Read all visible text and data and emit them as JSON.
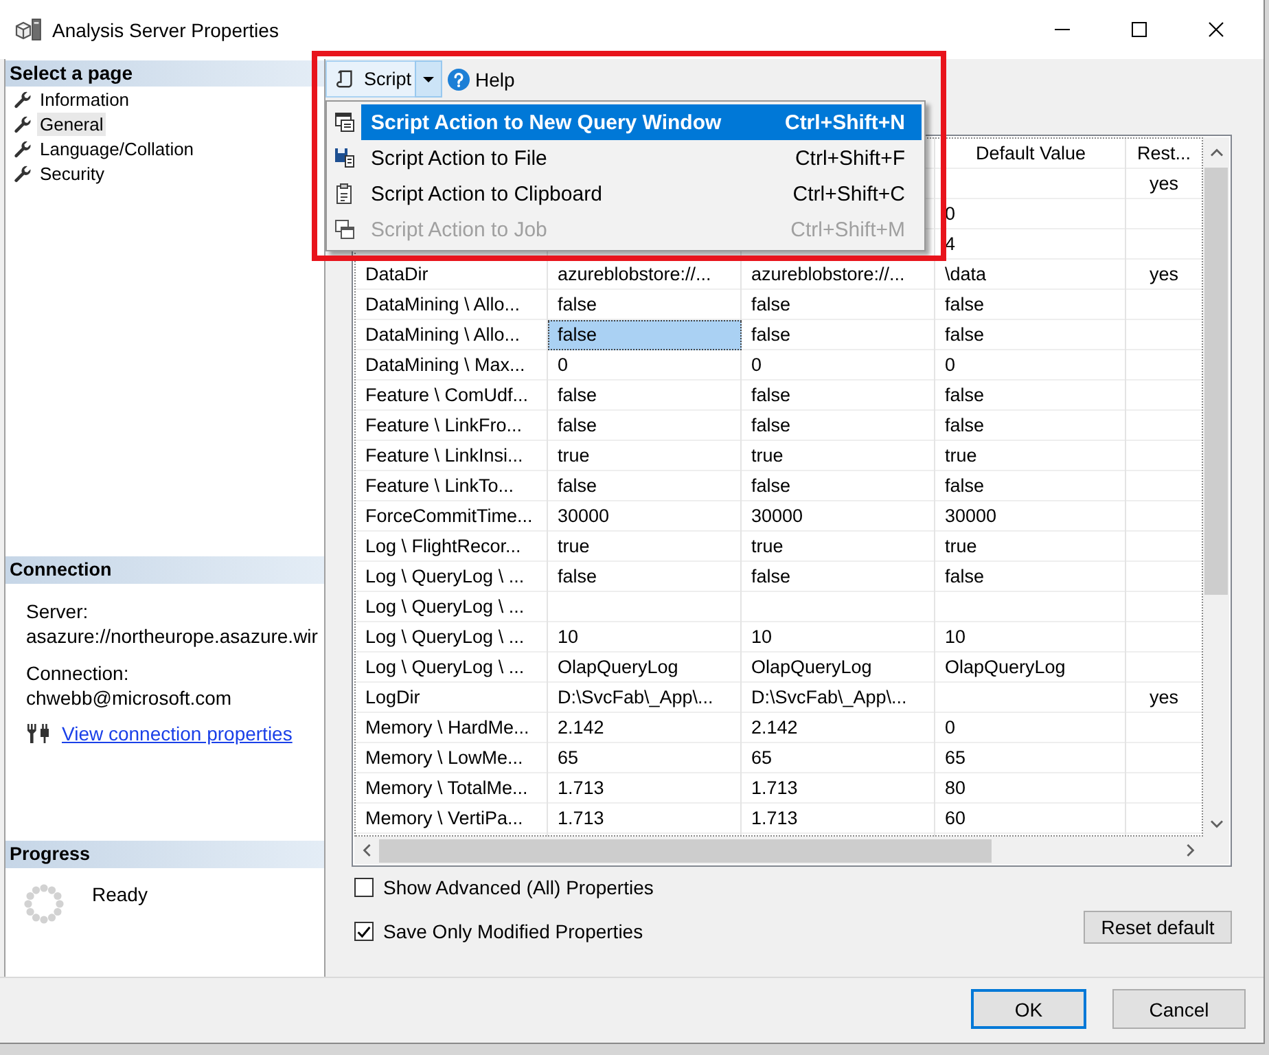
{
  "window": {
    "title": "Analysis Server Properties"
  },
  "sidebar": {
    "header": "Select a page",
    "items": [
      {
        "label": "Information",
        "selected": false
      },
      {
        "label": "General",
        "selected": true
      },
      {
        "label": "Language/Collation",
        "selected": false
      },
      {
        "label": "Security",
        "selected": false
      }
    ]
  },
  "connection": {
    "header": "Connection",
    "server_label": "Server:",
    "server": "asazure://northeurope.asazure.wir",
    "connection_label": "Connection:",
    "connection": "chwebb@microsoft.com",
    "link": "View connection properties"
  },
  "progress": {
    "header": "Progress",
    "status": "Ready"
  },
  "toolbar": {
    "script_button": "Script",
    "help_button": "Help"
  },
  "script_menu": {
    "open": true,
    "items": [
      {
        "label": "Script Action to New Query Window",
        "shortcut": "Ctrl+Shift+N",
        "selected": true,
        "disabled": false
      },
      {
        "label": "Script Action to File",
        "shortcut": "Ctrl+Shift+F",
        "selected": false,
        "disabled": false
      },
      {
        "label": "Script Action to Clipboard",
        "shortcut": "Ctrl+Shift+C",
        "selected": false,
        "disabled": false
      },
      {
        "label": "Script Action to Job",
        "shortcut": "Ctrl+Shift+M",
        "selected": false,
        "disabled": true
      }
    ]
  },
  "table": {
    "columns": [
      null,
      null,
      null,
      "Default Value",
      "Rest..."
    ],
    "rows": [
      {
        "cells": [
          null,
          null,
          null,
          null,
          "yes"
        ],
        "selected": false
      },
      {
        "cells": [
          null,
          null,
          null,
          "0",
          null
        ],
        "selected": false
      },
      {
        "cells": [
          null,
          null,
          null,
          "4",
          null
        ],
        "selected": false
      },
      {
        "cells": [
          "DataDir",
          "azureblobstore://...",
          "azureblobstore://...",
          "\\data",
          "yes"
        ],
        "selected": false
      },
      {
        "cells": [
          "DataMining \\ Allo...",
          "false",
          "false",
          "false",
          null
        ],
        "selected": false
      },
      {
        "cells": [
          "DataMining \\ Allo...",
          "false",
          "false",
          "false",
          null
        ],
        "selected": true
      },
      {
        "cells": [
          "DataMining \\ Max...",
          "0",
          "0",
          "0",
          null
        ],
        "selected": false
      },
      {
        "cells": [
          "Feature \\ ComUdf...",
          "false",
          "false",
          "false",
          null
        ],
        "selected": false
      },
      {
        "cells": [
          "Feature \\ LinkFro...",
          "false",
          "false",
          "false",
          null
        ],
        "selected": false
      },
      {
        "cells": [
          "Feature \\ LinkInsi...",
          "true",
          "true",
          "true",
          null
        ],
        "selected": false
      },
      {
        "cells": [
          "Feature \\ LinkTo...",
          "false",
          "false",
          "false",
          null
        ],
        "selected": false
      },
      {
        "cells": [
          "ForceCommitTime...",
          "30000",
          "30000",
          "30000",
          null
        ],
        "selected": false
      },
      {
        "cells": [
          "Log \\ FlightRecor...",
          "true",
          "true",
          "true",
          null
        ],
        "selected": false
      },
      {
        "cells": [
          "Log \\ QueryLog \\ ...",
          "false",
          "false",
          "false",
          null
        ],
        "selected": false
      },
      {
        "cells": [
          "Log \\ QueryLog \\ ...",
          null,
          null,
          null,
          null
        ],
        "selected": false
      },
      {
        "cells": [
          "Log \\ QueryLog \\ ...",
          "10",
          "10",
          "10",
          null
        ],
        "selected": false
      },
      {
        "cells": [
          "Log \\ QueryLog \\ ...",
          "OlapQueryLog",
          "OlapQueryLog",
          "OlapQueryLog",
          null
        ],
        "selected": false
      },
      {
        "cells": [
          "LogDir",
          "D:\\SvcFab\\_App\\...",
          "D:\\SvcFab\\_App\\...",
          null,
          "yes"
        ],
        "selected": false
      },
      {
        "cells": [
          "Memory \\ HardMe...",
          "2.142",
          "2.142",
          "0",
          null
        ],
        "selected": false
      },
      {
        "cells": [
          "Memory \\ LowMe...",
          "65",
          "65",
          "65",
          null
        ],
        "selected": false
      },
      {
        "cells": [
          "Memory \\ TotalMe...",
          "1.713",
          "1.713",
          "80",
          null
        ],
        "selected": false
      },
      {
        "cells": [
          "Memory \\ VertiPa...",
          "1.713",
          "1.713",
          "60",
          null
        ],
        "selected": false
      }
    ]
  },
  "options": [
    {
      "label": "Show Advanced (All) Properties",
      "checked": false
    },
    {
      "label": "Save Only Modified Properties",
      "checked": true
    }
  ],
  "reset_button": "Reset default",
  "buttons": [
    {
      "label": "OK",
      "default": true
    },
    {
      "label": "Cancel",
      "default": false
    }
  ]
}
